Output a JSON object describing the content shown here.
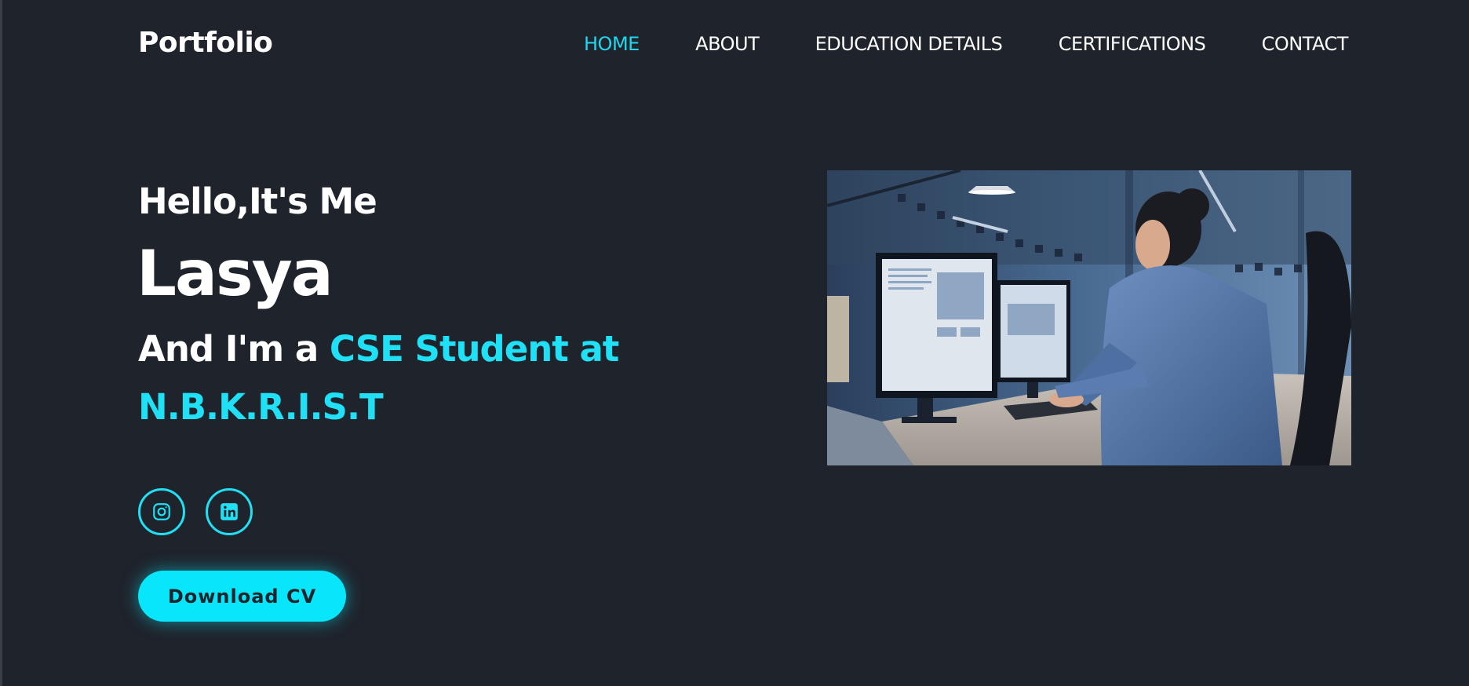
{
  "logo": "Portfolio",
  "nav": {
    "items": [
      {
        "label": "HOME",
        "active": true
      },
      {
        "label": "ABOUT",
        "active": false
      },
      {
        "label": "EDUCATION DETAILS",
        "active": false
      },
      {
        "label": "CERTIFICATIONS",
        "active": false
      },
      {
        "label": "CONTACT",
        "active": false
      }
    ]
  },
  "hero": {
    "greeting": "Hello,It's Me",
    "name": "Lasya",
    "role_prefix": "And I'm a ",
    "role_highlight": "CSE Student at N.B.K.R.I.S.T",
    "cv_button": "Download CV"
  },
  "social": [
    {
      "icon": "instagram-icon"
    },
    {
      "icon": "linkedin-icon"
    }
  ],
  "colors": {
    "background": "#1f232b",
    "accent": "#1fe0f4",
    "button": "#07e6fb"
  }
}
